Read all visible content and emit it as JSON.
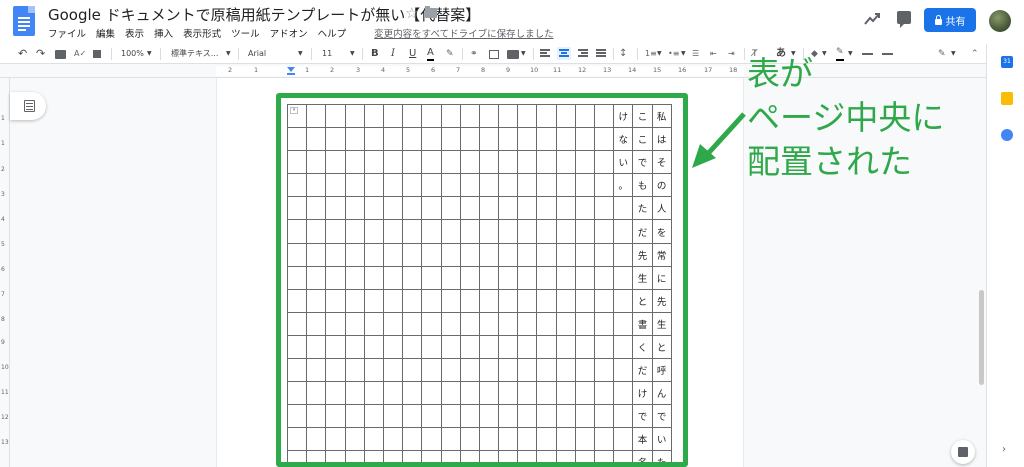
{
  "app": {
    "title": "Google ドキュメントで原稿用紙テンプレートが無い【代替案】",
    "menu": [
      "ファイル",
      "編集",
      "表示",
      "挿入",
      "表示形式",
      "ツール",
      "アドオン",
      "ヘルプ"
    ],
    "save_status": "変更内容をすべてドライブに保存しました",
    "share_label": "共有"
  },
  "toolbar": {
    "zoom": "100%",
    "style": "標準テキス...",
    "font": "Arial",
    "font_size": "11",
    "bold": "B",
    "italic": "I",
    "underline": "U",
    "text_color": "A",
    "input_tools": "あ"
  },
  "ruler": {
    "labels": [
      "2",
      "1",
      "1",
      "2",
      "3",
      "4",
      "5",
      "6",
      "7",
      "8",
      "9",
      "10",
      "11",
      "12",
      "13",
      "14",
      "15",
      "16",
      "17",
      "18"
    ]
  },
  "vruler": {
    "labels": [
      "1",
      "1",
      "2",
      "3",
      "4",
      "5",
      "6",
      "7",
      "8",
      "9",
      "10",
      "11",
      "12",
      "13"
    ]
  },
  "table": {
    "columns": 20,
    "text_columns": [
      {
        "col": 17,
        "chars": [
          "け",
          "な",
          "い",
          "。"
        ]
      },
      {
        "col": 18,
        "chars": [
          "こ",
          "こ",
          "で",
          "も",
          "た",
          "だ",
          "先",
          "生",
          "と",
          "書",
          "く",
          "だ",
          "け",
          "で",
          "本",
          "名"
        ]
      },
      {
        "col": 19,
        "chars": [
          "私",
          "は",
          "そ",
          "の",
          "人",
          "を",
          "常",
          "に",
          "先",
          "生",
          "と",
          "呼",
          "ん",
          "で",
          "い",
          "た"
        ]
      }
    ]
  },
  "annotation": {
    "lines": [
      "表が",
      "ページ中央に",
      "配置された"
    ],
    "color": "#2fa84a"
  },
  "colors": {
    "accent": "#1a73e8",
    "table_border": "#2faa4a"
  }
}
